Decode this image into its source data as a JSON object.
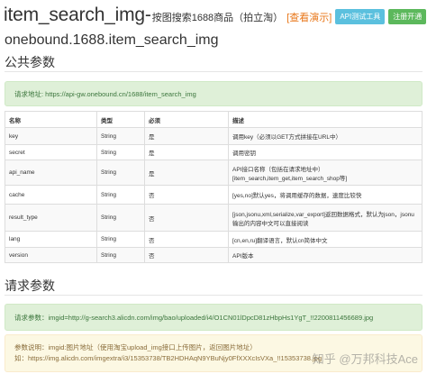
{
  "header": {
    "title": "item_search_img-",
    "subtitle": "按图搜索1688商品（拍立淘）",
    "demo_link": "[查看演示]",
    "btn_test": "API测试工具",
    "btn_register": "注册开通"
  },
  "api_name": "onebound.1688.item_search_img",
  "sections": {
    "public": "公共参数",
    "request": "请求参数"
  },
  "request_url": "请求地址: https://api-gw.onebound.cn/1688/item_search_img",
  "table": {
    "headers": [
      "名称",
      "类型",
      "必须",
      "描述"
    ],
    "rows": [
      {
        "name": "key",
        "type": "String",
        "required": "是",
        "desc": "调用key（必须以GET方式拼接在URL中）"
      },
      {
        "name": "secret",
        "type": "String",
        "required": "是",
        "desc": "调用密钥"
      },
      {
        "name": "api_name",
        "type": "String",
        "required": "是",
        "desc": "API接口名称（包括在请求地址中）[item_search,item_get,item_search_shop等]"
      },
      {
        "name": "cache",
        "type": "String",
        "required": "否",
        "desc": "[yes,no]默认yes，将调用缓存的数据，速度比较快"
      },
      {
        "name": "result_type",
        "type": "String",
        "required": "否",
        "desc": "[json,jsonu,xml,serialize,var_export]返回数据格式，默认为json，jsonu输出的内容中文可以直接阅读"
      },
      {
        "name": "lang",
        "type": "String",
        "required": "否",
        "desc": "[cn,en,ru]翻译语言，默认cn简体中文"
      },
      {
        "name": "version",
        "type": "String",
        "required": "否",
        "desc": "API版本"
      }
    ]
  },
  "request_params": "请求参数：imgid=http://g-search3.alicdn.com/img/bao/uploaded/i4/O1CN01lDpcD81zHbpHs1YgT_!!2200811456689.jpg",
  "param_desc": {
    "line1": "参数说明：imgid:图片地址（使用淘宝upload_img接口上传图片，返回图片地址）",
    "line2": "如：https://img.alicdn.com/imgextra/i3/15353738/TB2HDHAqN9YBuNjy0FfXXXcIsVXa_!!15353738.jpg"
  },
  "watermark": "知乎 @万邦科技Ace"
}
